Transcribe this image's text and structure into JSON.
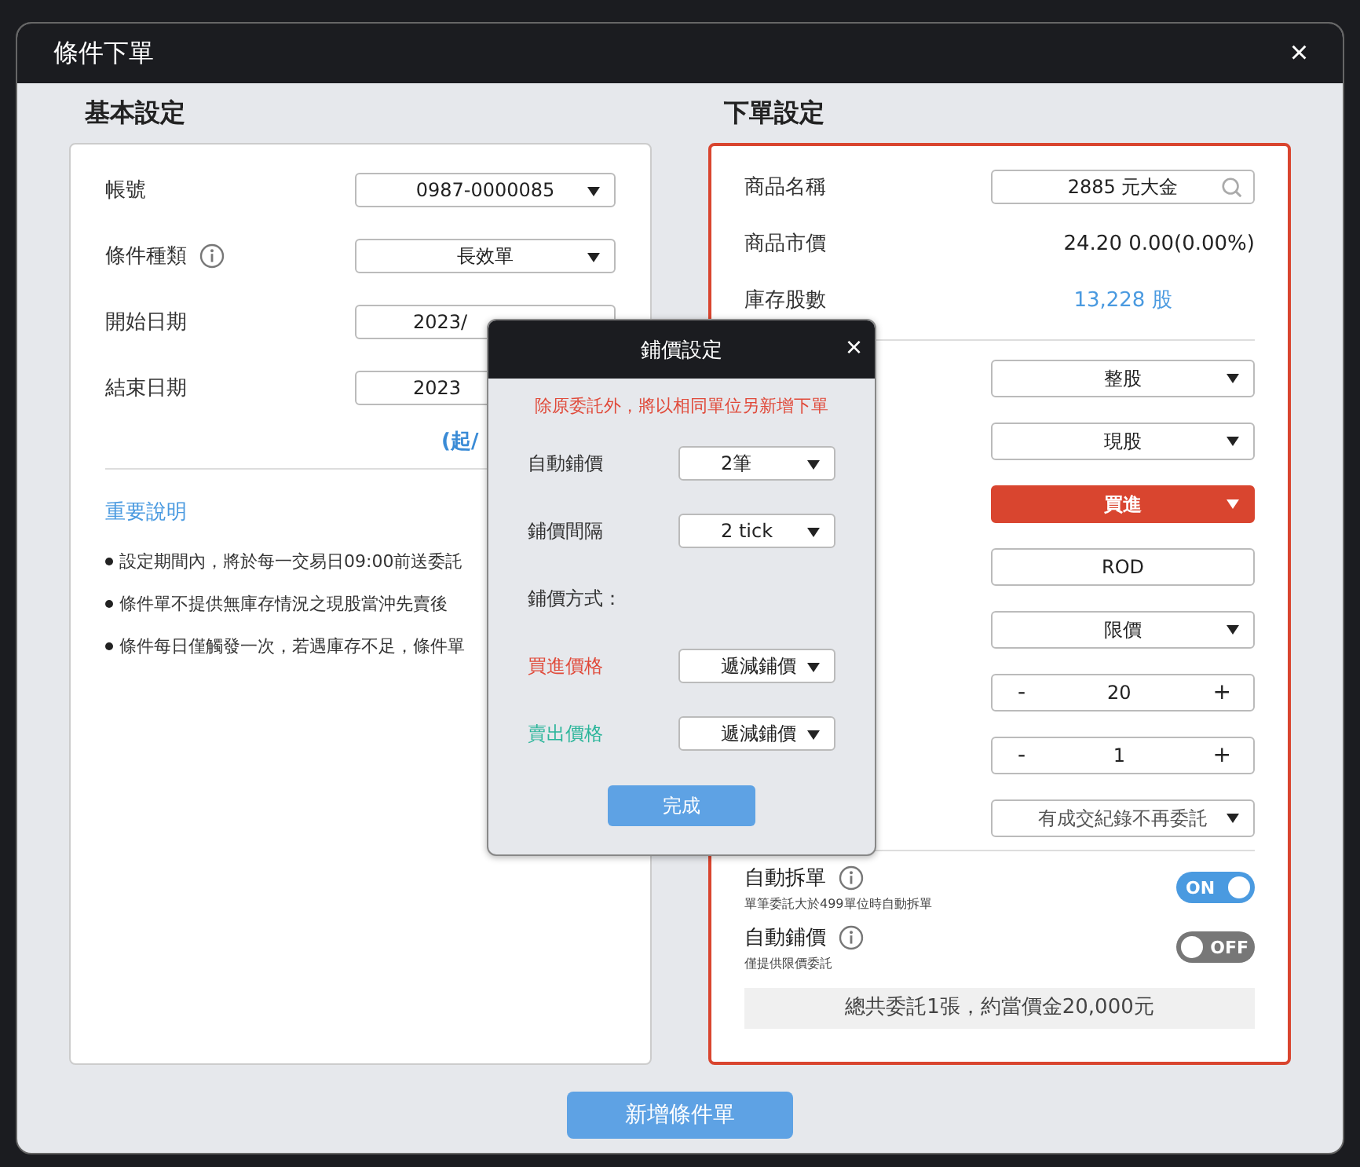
{
  "window": {
    "title": "條件下單"
  },
  "basic": {
    "title": "基本設定",
    "fields": [
      {
        "label": "帳號",
        "value": "0987-0000085",
        "info": false,
        "kind": "select"
      },
      {
        "label": "條件種類",
        "value": "長效單",
        "info": true,
        "kind": "select"
      },
      {
        "label": "開始日期",
        "value": "2023/",
        "info": false,
        "kind": "date"
      },
      {
        "label": "結束日期",
        "value": "2023",
        "info": false,
        "kind": "plain"
      }
    ],
    "link": "(起/",
    "notes_title": "重要說明",
    "notes": [
      "設定期間內，將於每一交易日09:00前送委託",
      "條件單不提供無庫存情況之現股當沖先賣後",
      "條件每日僅觸發一次，若遇庫存不足，條件單"
    ]
  },
  "order": {
    "title": "下單設定",
    "product": {
      "label": "商品名稱",
      "value": "2885 元大金"
    },
    "price": {
      "label": "商品市價",
      "value": "24.20  0.00(0.00%)"
    },
    "stock": {
      "label": "庫存股數",
      "value": "13,228 股"
    },
    "controls": [
      {
        "kind": "select",
        "value": "整股"
      },
      {
        "kind": "select-active",
        "value": "現股"
      },
      {
        "kind": "select-buy",
        "value": "買進"
      },
      {
        "kind": "text",
        "value": "ROD"
      },
      {
        "kind": "select",
        "value": "限價"
      },
      {
        "kind": "stepper",
        "value": "20",
        "minus": "-",
        "plus": "+"
      },
      {
        "kind": "stepper",
        "value": "1",
        "minus": "-",
        "plus": "+"
      },
      {
        "kind": "select",
        "value": "有成交紀錄不再委託"
      }
    ],
    "toggles": [
      {
        "label": "自動拆單",
        "hint": "單筆委託大於499單位時自動拆單",
        "on": true,
        "text": "ON"
      },
      {
        "label": "自動鋪價",
        "hint": "僅提供限價委託",
        "on": false,
        "text": "OFF"
      }
    ],
    "summary": "總共委託1張，約當價金20,000元"
  },
  "submit": "新增條件單",
  "popup": {
    "title": "鋪價設定",
    "close": "×",
    "note": "除原委託外，將以相同單位另新增下單",
    "rows": [
      {
        "label": "自動鋪價",
        "value": "2筆",
        "kind": "select",
        "color": "#333333"
      },
      {
        "label": "鋪價間隔",
        "value": "2 tick",
        "kind": "select",
        "color": "#333333"
      },
      {
        "label": "鋪價方式：",
        "kind": "heading",
        "color": "#333333"
      },
      {
        "label": "買進價格",
        "value": "遞減鋪價",
        "kind": "select",
        "color": "#e04a3a"
      },
      {
        "label": "賣出價格",
        "value": "遞減鋪價",
        "kind": "select",
        "color": "#2bb59a"
      }
    ],
    "done": "完成"
  },
  "close": "×"
}
